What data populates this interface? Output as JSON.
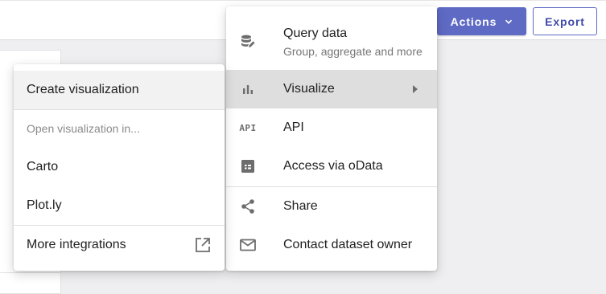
{
  "header": {
    "actions_label": "Actions",
    "export_label": "Export"
  },
  "actions_menu": {
    "query_data": {
      "label": "Query data",
      "sublabel": "Group, aggregate and more",
      "icon": "database-edit-icon"
    },
    "visualize": {
      "label": "Visualize",
      "icon": "bar-chart-icon"
    },
    "api": {
      "label": "API",
      "icon": "api-icon",
      "icon_text": "API"
    },
    "odata": {
      "label": "Access via oData",
      "icon": "table-grid-icon"
    },
    "share": {
      "label": "Share",
      "icon": "share-icon"
    },
    "contact": {
      "label": "Contact dataset owner",
      "icon": "mail-icon"
    }
  },
  "visualize_submenu": {
    "create": "Create visualization",
    "open_caption": "Open visualization in...",
    "carto": "Carto",
    "plotly": "Plot.ly",
    "more": "More integrations",
    "more_icon": "open-in-new-icon"
  },
  "colors": {
    "primary": "#5f6ac4",
    "primary_text": "#3f4aa8",
    "hover": "#dedede",
    "icon": "#6d6d6d"
  }
}
